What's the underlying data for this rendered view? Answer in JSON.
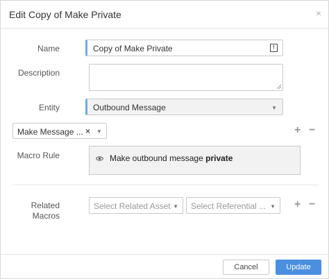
{
  "dialog": {
    "title": "Edit Copy of Make Private",
    "close_glyph": "×"
  },
  "form": {
    "name_label": "Name",
    "name_value": "Copy of Make Private",
    "name_badge": "!",
    "description_label": "Description",
    "description_value": "",
    "entity_label": "Entity",
    "entity_value": "Outbound Message",
    "macro_select_value": "Make Message ...",
    "macro_rule_label": "Macro Rule",
    "macro_rule_text": "Make outbound message",
    "macro_rule_bold": "private",
    "related_macros_label_line1": "Related",
    "related_macros_label_line2": "Macros",
    "related_asset_placeholder": "Select Related Asset",
    "referential_placeholder": "Select Referential ..."
  },
  "footer": {
    "cancel_label": "Cancel",
    "update_label": "Update"
  },
  "colors": {
    "accent": "#6aaee8",
    "primary_button": "#4a8fe0"
  },
  "icons": {
    "close": "close-icon",
    "warning_badge": "exclamation-icon",
    "dropdown": "chevron-down-icon",
    "clear": "clear-icon",
    "add": "plus-icon",
    "remove": "minus-icon",
    "view": "eye-icon"
  }
}
